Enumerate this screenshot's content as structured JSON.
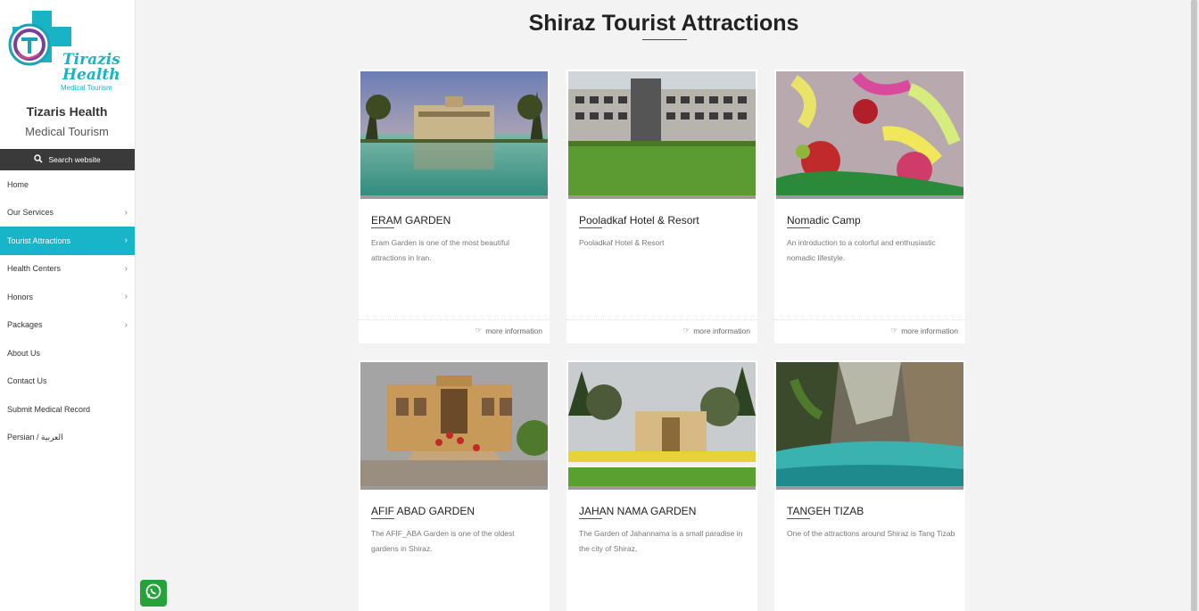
{
  "sidebar": {
    "logo": {
      "line1": "Tirazis",
      "line2": "Health",
      "line3": "Medical Tourism"
    },
    "brand_name": "Tizaris Health",
    "brand_sub": "Medical Tourism",
    "search_label": "Search website",
    "nav": [
      {
        "label": "Home",
        "has_arrow": false,
        "active": false
      },
      {
        "label": "Our Services",
        "has_arrow": true,
        "active": false
      },
      {
        "label": "Tourist Attractions",
        "has_arrow": true,
        "active": true
      },
      {
        "label": "Health Centers",
        "has_arrow": true,
        "active": false
      },
      {
        "label": "Honors",
        "has_arrow": true,
        "active": false
      },
      {
        "label": "Packages",
        "has_arrow": true,
        "active": false
      },
      {
        "label": "About Us",
        "has_arrow": false,
        "active": false
      },
      {
        "label": "Contact Us",
        "has_arrow": false,
        "active": false
      },
      {
        "label": "Submit Medical Record",
        "has_arrow": false,
        "active": false
      },
      {
        "label": "Persian / العربية",
        "has_arrow": false,
        "active": false
      }
    ]
  },
  "main": {
    "title": "Shiraz Tourist Attractions",
    "more_label": "more information",
    "cards": [
      {
        "title": "ERAM GARDEN",
        "desc": "Eram Garden is one of the most beautiful attractions in Iran.",
        "image": "eram-garden-photo",
        "show_more": true
      },
      {
        "title": "Pooladkaf Hotel & Resort",
        "desc": "Pooladkaf Hotel & Resort",
        "image": "pooladkaf-hotel-photo",
        "show_more": true
      },
      {
        "title": "Nomadic Camp",
        "desc": "An introduction to a colorful and enthusiastic nomadic lifestyle.",
        "image": "nomadic-camp-photo",
        "show_more": true
      },
      {
        "title": "AFIF ABAD GARDEN",
        "desc": "The AFIF_ABA Garden is one of the oldest gardens in Shiraz.",
        "image": "afif-abad-garden-photo",
        "show_more": false
      },
      {
        "title": "JAHAN NAMA GARDEN",
        "desc": "The Garden of Jahannama is a small paradise in the city of Shiraz,",
        "image": "jahan-nama-garden-photo",
        "show_more": false
      },
      {
        "title": "TANGEH TIZAB",
        "desc": "One of the attractions around Shiraz is Tang Tizab",
        "image": "tangeh-tizab-photo",
        "show_more": false
      }
    ]
  },
  "colors": {
    "accent": "#18b4c8",
    "whatsapp": "#25a33a",
    "search_bg": "#3a3a3a"
  },
  "icons": [
    "search-icon",
    "chevron-right-icon",
    "hand-pointing-icon",
    "whatsapp-icon"
  ]
}
